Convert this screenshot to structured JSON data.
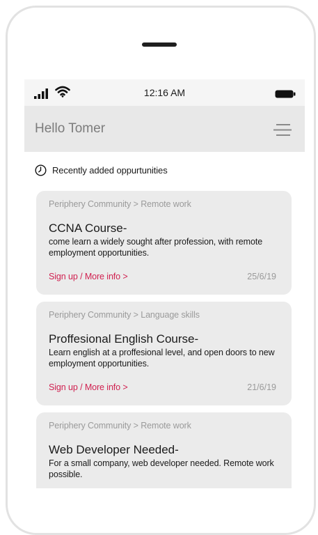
{
  "status_bar": {
    "time": "12:16 AM"
  },
  "header": {
    "greeting": "Hello Tomer"
  },
  "section": {
    "title": "Recently added oppurtunities"
  },
  "icons": {
    "signal": "signal-bars-icon",
    "wifi": "wifi-icon",
    "battery": "battery-icon",
    "menu": "hamburger-menu-icon",
    "clock": "clock-icon"
  },
  "colors": {
    "accent_link": "#d01f4f",
    "card_background": "#ebebeb",
    "header_background": "#e8e8e8",
    "muted_text": "#9a9a9a"
  },
  "cards": [
    {
      "breadcrumb": "Periphery Community > Remote work",
      "title": "CCNA Course-",
      "description": "come learn a widely sought after profession, with remote employment opportunities.",
      "link": "Sign up / More info >",
      "date": "25/6/19"
    },
    {
      "breadcrumb": "Periphery Community > Language skills",
      "title": "Proffesional English Course-",
      "description": "Learn english at a proffesional level, and open doors to new employment opportunities.",
      "link": "Sign up / More info >",
      "date": "21/6/19"
    },
    {
      "breadcrumb": "Periphery Community > Remote work",
      "title": "Web Developer Needed-",
      "description": "For a small company, web developer needed. Remote work possible.",
      "link": "",
      "date": ""
    }
  ]
}
